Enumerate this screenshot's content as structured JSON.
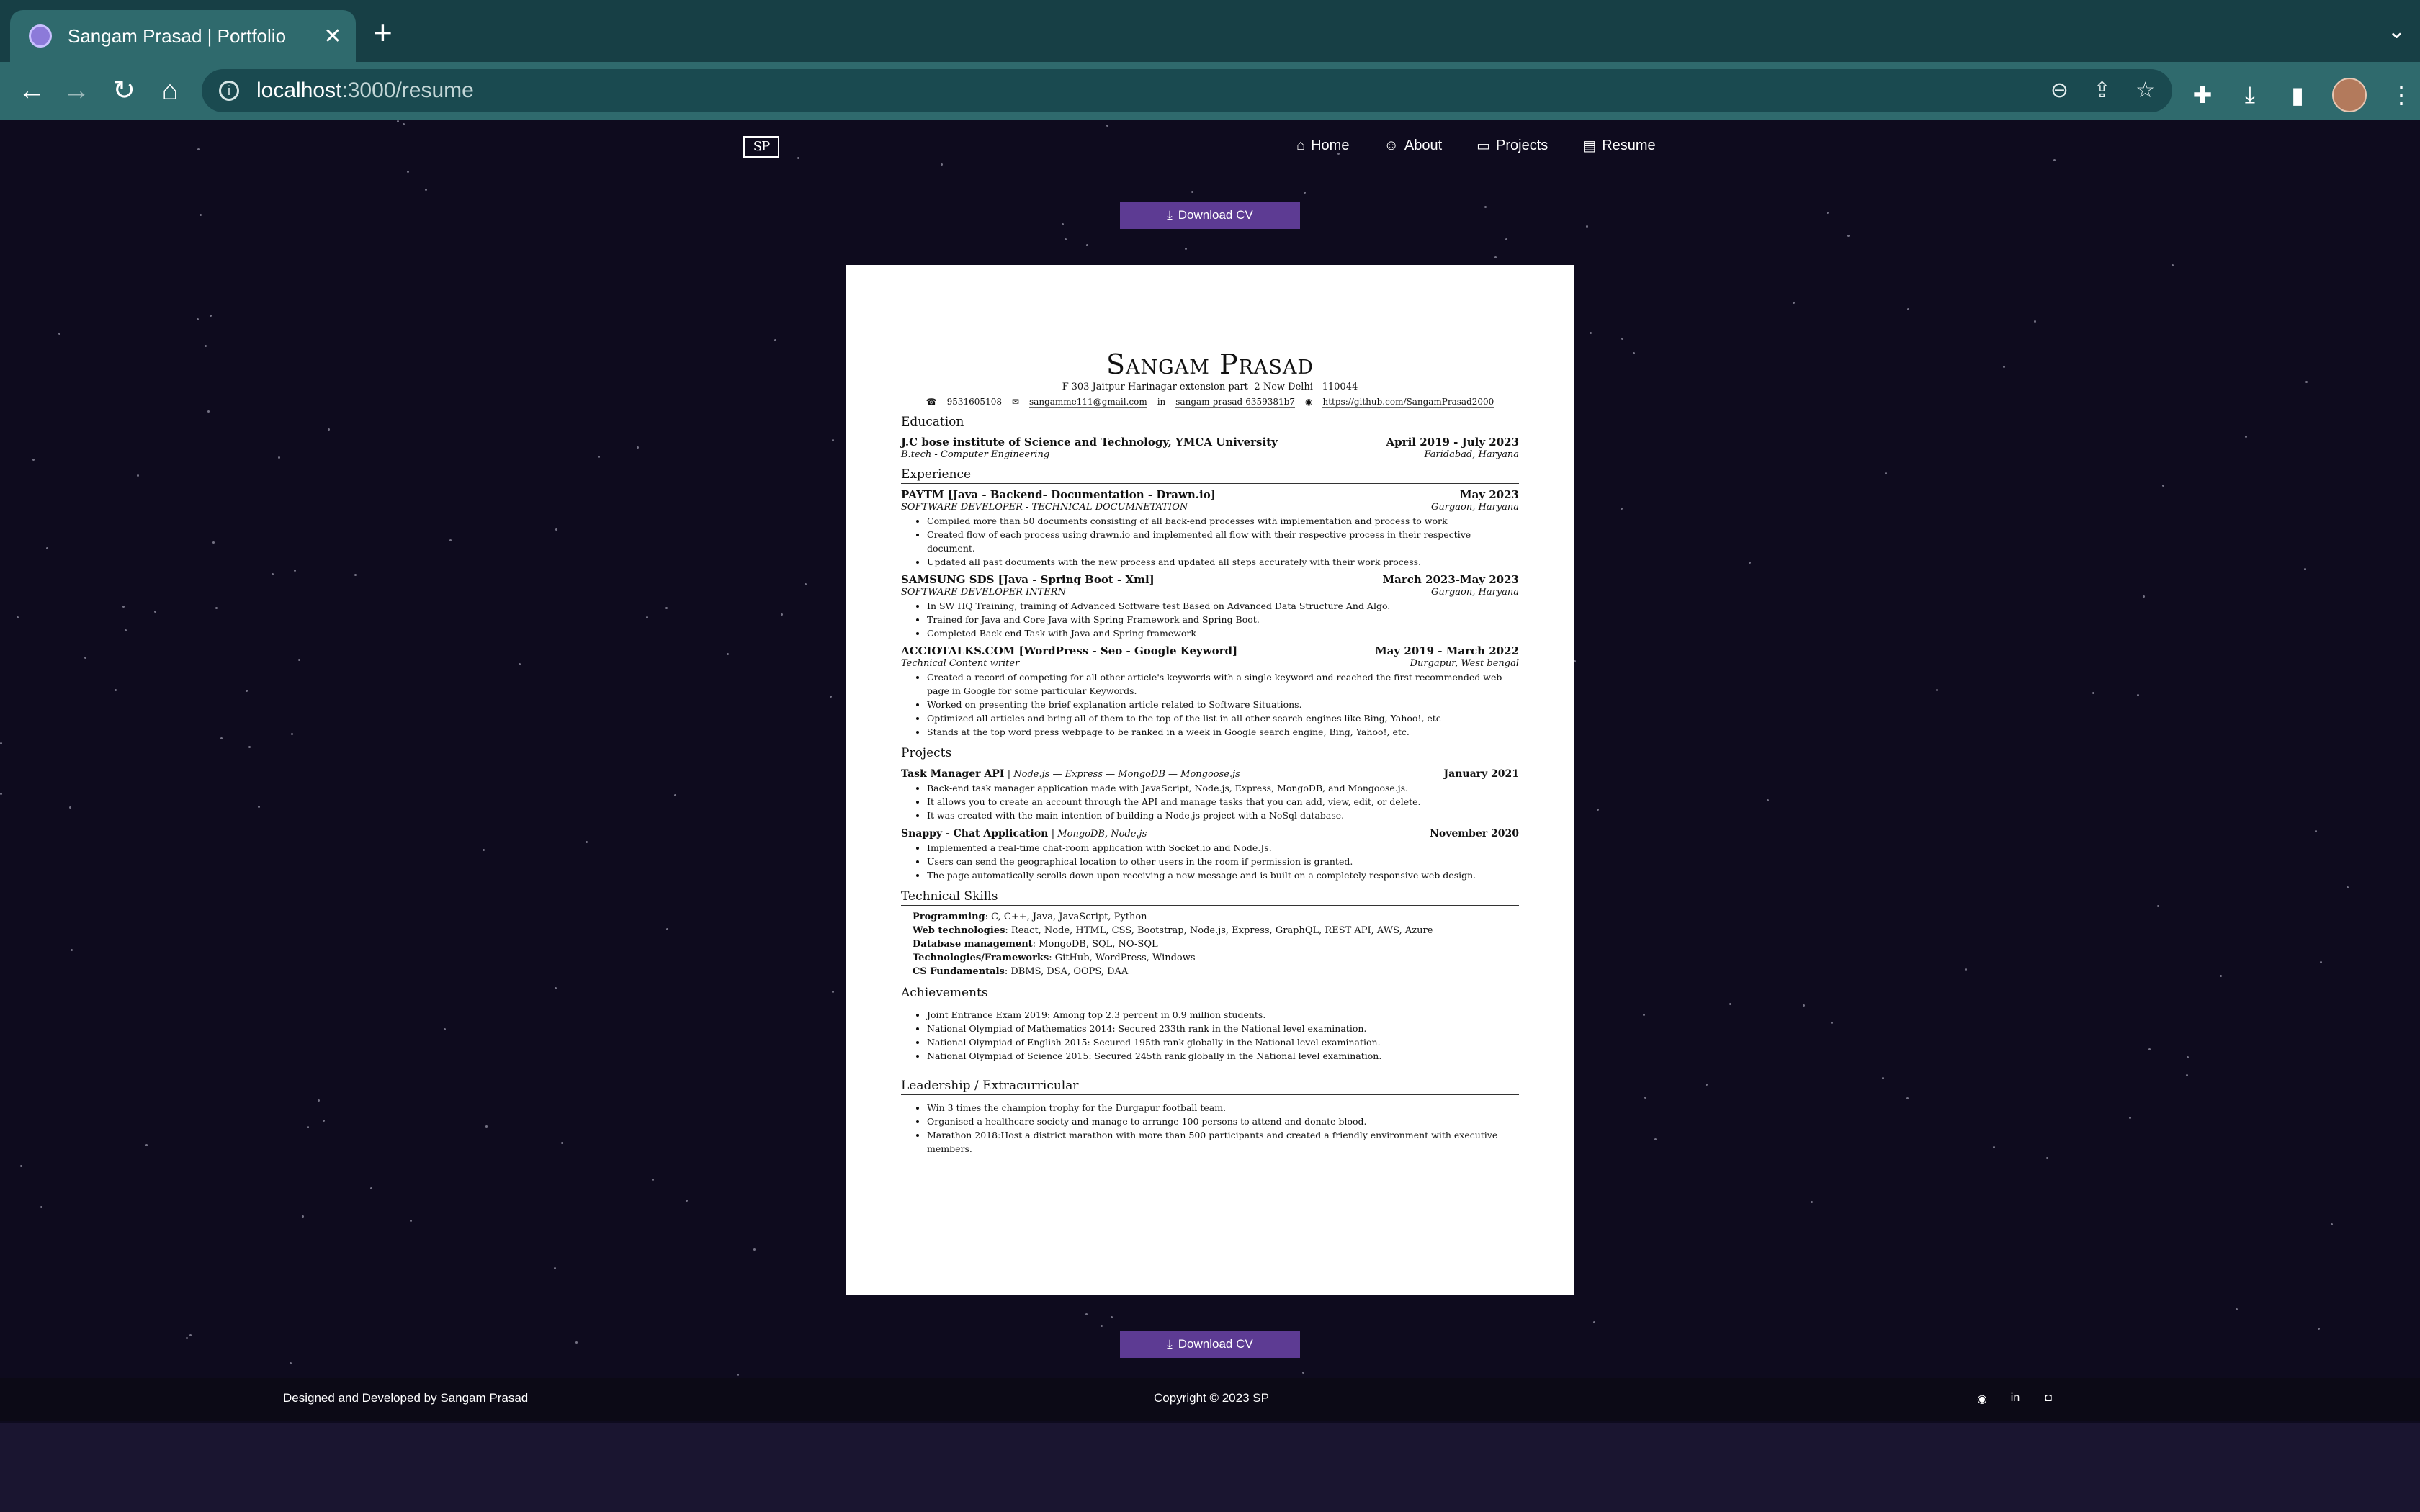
{
  "browser": {
    "tab_title": "Sangam Prasad | Portfolio",
    "tab_close": "✕",
    "new_tab": "+",
    "url_host": "localhost",
    "url_path": ":3000/resume"
  },
  "nav": {
    "logo": "SP",
    "home": "Home",
    "about": "About",
    "projects": "Projects",
    "resume": "Resume"
  },
  "download_label": "Download CV",
  "resume": {
    "name": "Sangam Prasad",
    "address": "F-303 Jaitpur Harinagar extension part -2 New Delhi - 110044",
    "phone": "9531605108",
    "email": "sangamme111@gmail.com",
    "linkedin": "sangam-prasad-6359381b7",
    "github": "https://github.com/SangamPrasad2000",
    "education_heading": "Education",
    "education": {
      "school": "J.C bose institute of Science and Technology, YMCA University",
      "dates": "April 2019 - July 2023",
      "degree": "B.tech - Computer Engineering",
      "location": "Faridabad, Haryana"
    },
    "experience_heading": "Experience",
    "experience": [
      {
        "title": "PAYTM [Java - Backend- Documentation - Drawn.io]",
        "dates": "May 2023",
        "role": "SOFTWARE DEVELOPER - TECHNICAL DOCUMNETATION",
        "location": "Gurgaon, Haryana",
        "bullets": [
          "Compiled more than 50 documents consisting of all back-end processes with implementation and process to work",
          "Created flow of each process using drawn.io and implemented all flow with their respective process in their respective document.",
          "Updated all past documents with the new process and updated all steps accurately with their work process."
        ]
      },
      {
        "title": "SAMSUNG SDS [Java - Spring Boot - Xml]",
        "dates": "March 2023-May 2023",
        "role": "SOFTWARE DEVELOPER INTERN",
        "location": "Gurgaon, Haryana",
        "bullets": [
          "In SW HQ Training, training of Advanced Software test Based on Advanced Data Structure And Algo.",
          "Trained for Java and Core Java with Spring Framework and Spring Boot.",
          "Completed Back-end Task with Java and Spring framework"
        ]
      },
      {
        "title": "ACCIOTALKS.COM [WordPress - Seo - Google Keyword]",
        "dates": "May 2019 - March 2022",
        "role": "Technical Content writer",
        "location": "Durgapur, West bengal",
        "bullets": [
          "Created a record of competing for all other article's keywords with a single keyword and reached the first recommended web page in Google for some particular Keywords.",
          "Worked on presenting the brief explanation article related to Software Situations.",
          "Optimized all articles and bring all of them to the top of the list in all other search engines like Bing, Yahoo!, etc",
          "Stands at the top word press webpage to be ranked in a week in Google search engine, Bing, Yahoo!, etc."
        ]
      }
    ],
    "projects_heading": "Projects",
    "projects": [
      {
        "title": "Task Manager API",
        "tech": "| Node.js — Express — MongoDB — Mongoose.js",
        "date": "January 2021",
        "bullets": [
          "Back-end task manager application made with JavaScript, Node.js, Express, MongoDB, and Mongoose.js.",
          "It allows you to create an account through the API and manage tasks that you can add, view, edit, or delete.",
          "It was created with the main intention of building a Node.js project with a NoSql database."
        ]
      },
      {
        "title": "Snappy - Chat Application",
        "tech": "| MongoDB, Node.js",
        "date": "November 2020",
        "bullets": [
          "Implemented a real-time chat-room application with Socket.io and Node.Js.",
          "Users can send the geographical location to other users in the room if permission is granted.",
          "The page automatically scrolls down upon receiving a new message and is built on a completely responsive web design."
        ]
      }
    ],
    "skills_heading": "Technical Skills",
    "skills": [
      {
        "label": "Programming",
        "value": ": C, C++, Java, JavaScript, Python"
      },
      {
        "label": "Web technologies",
        "value": ": React, Node, HTML, CSS, Bootstrap, Node.js, Express, GraphQL, REST API, AWS, Azure"
      },
      {
        "label": "Database management",
        "value": ": MongoDB, SQL, NO-SQL"
      },
      {
        "label": "Technologies/Frameworks",
        "value": ": GitHub, WordPress, Windows"
      },
      {
        "label": "CS Fundamentals",
        "value": ": DBMS, DSA, OOPS, DAA"
      }
    ],
    "achievements_heading": "Achievements",
    "achievements": [
      "Joint Entrance Exam 2019: Among top 2.3 percent in 0.9 million students.",
      "National Olympiad of Mathematics 2014: Secured 233th rank in the National level examination.",
      "National Olympiad of English 2015: Secured 195th rank globally in the National level examination.",
      "National Olympiad of Science 2015: Secured 245th rank globally in the National level examination."
    ],
    "leadership_heading": "Leadership / Extracurricular",
    "leadership": [
      "Win 3 times the champion trophy for the Durgapur football team.",
      "Organised a healthcare society and manage to arrange 100 persons to attend and donate blood.",
      "Marathon 2018:Host a district marathon with more than 500 participants and created a friendly environment with executive members."
    ]
  },
  "footer": {
    "credit": "Designed and Developed by Sangam Prasad",
    "copyright": "Copyright © 2023 SP"
  },
  "icons": {
    "tab_menu": "chevron-down-icon",
    "social": [
      "github-icon",
      "linkedin-icon",
      "instagram-icon"
    ]
  },
  "colors": {
    "background": "#0e0b1e",
    "accent_button": "#5d3b93",
    "browser_chrome": "#2f6a6d"
  }
}
